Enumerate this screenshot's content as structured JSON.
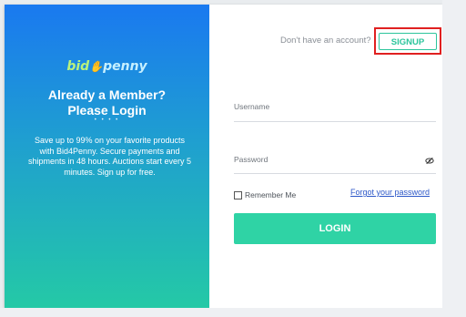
{
  "left_panel": {
    "brand": {
      "part1": "bid",
      "hand": "✋",
      "part2": "penny"
    },
    "title_line1": "Already a Member?",
    "title_line2": "Please Login",
    "dots": "• • • •",
    "description": "Save up to 99% on your favorite products with Bid4Penny. Secure payments and shipments in 48 hours. Auctions start every 5 minutes. Sign up for free."
  },
  "right_panel": {
    "no_account_text": "Don't have an account?",
    "signup_label": "SIGNUP",
    "username_label": "Username",
    "password_label": "Password",
    "remember_label": "Remember Me",
    "forgot_label": "Forgot your password",
    "login_label": "LOGIN"
  },
  "colors": {
    "gradient_top": "#1a79f0",
    "gradient_bottom": "#24c9a6",
    "accent": "#2fd3a5",
    "highlight_box": "#e02020"
  }
}
